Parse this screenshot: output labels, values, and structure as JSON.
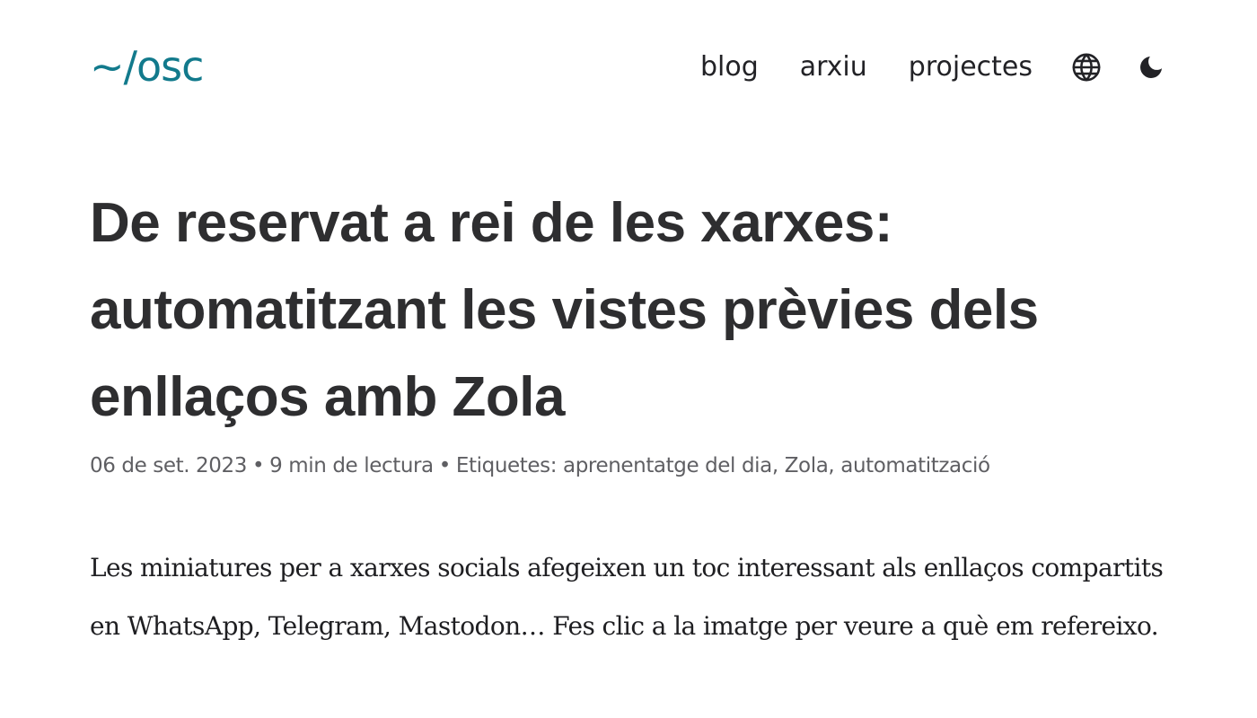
{
  "header": {
    "logo": "~/osc",
    "nav": {
      "blog": "blog",
      "archive": "arxiu",
      "projects": "projectes"
    },
    "icons": {
      "language": "globe-icon",
      "theme": "moon-icon"
    }
  },
  "article": {
    "title": "De reservat a rei de les xarxes: automatitzant les vistes prèvies dels enllaços amb Zola",
    "meta": {
      "date": "06 de set. 2023",
      "separator": "•",
      "reading_time": "9 min de lectura",
      "tags_label": "Etiquetes:",
      "tags": [
        "aprenentatge del dia",
        "Zola",
        "automatització"
      ]
    },
    "intro": "Les miniatures per a xarxes socials afegeixen un toc interessant als enllaços compartits en WhatsApp, Telegram, Mastodon… Fes clic a la imatge per veure a què em refereixo."
  },
  "colors": {
    "accent": "#127a8c",
    "text": "#222226",
    "meta": "#5f5f63"
  }
}
